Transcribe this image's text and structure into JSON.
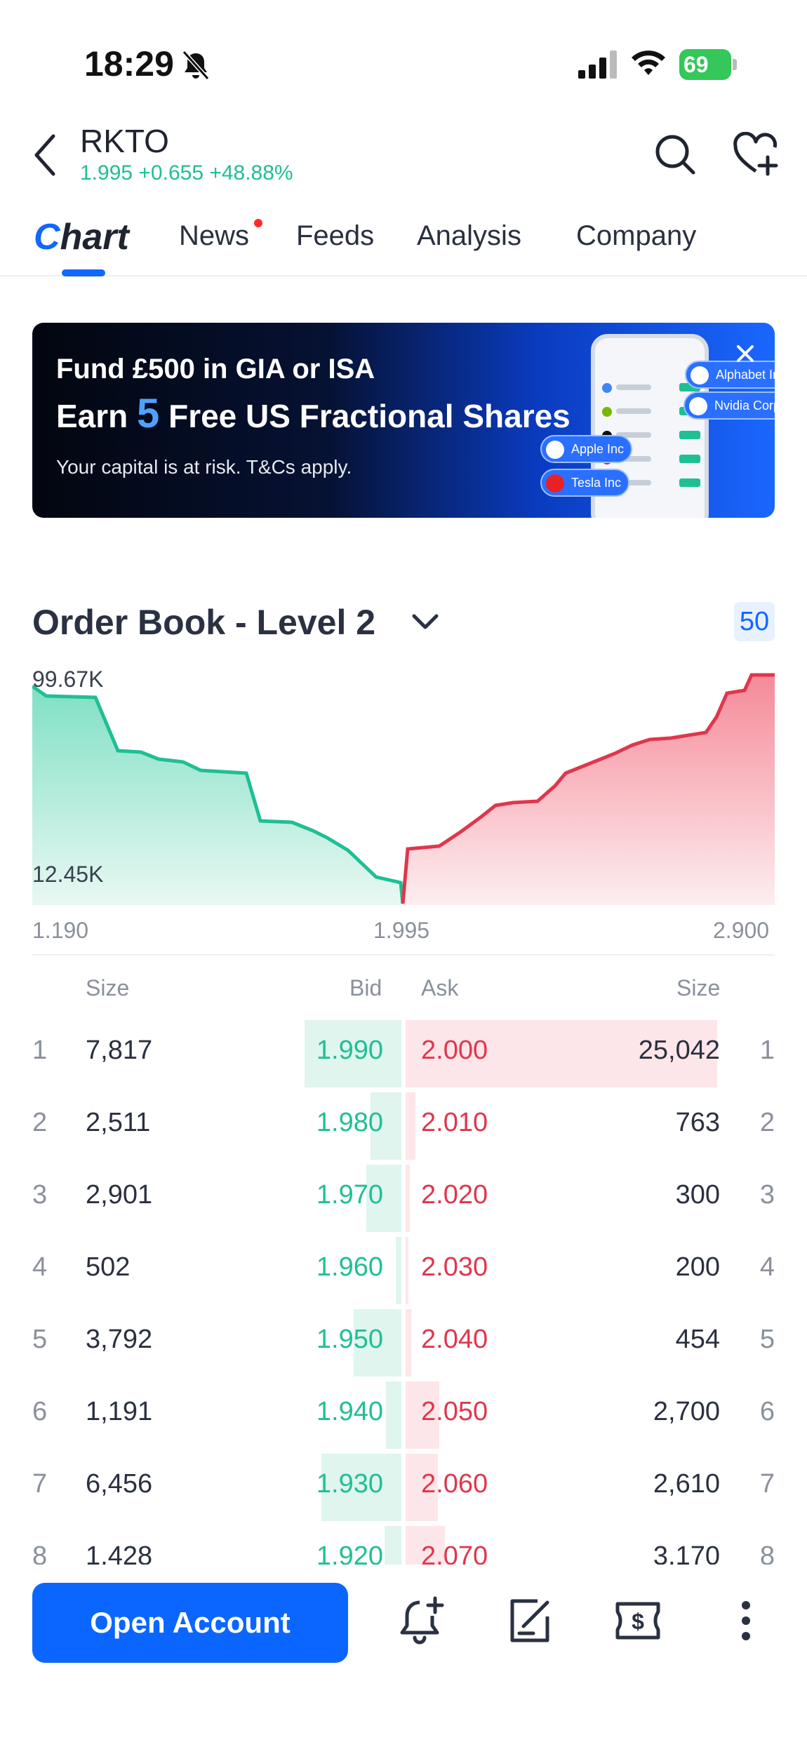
{
  "status_bar": {
    "time": "18:29",
    "battery": "69"
  },
  "header": {
    "symbol": "RKTO",
    "quote": "1.995 +0.655 +48.88%"
  },
  "tabs": [
    {
      "label": "Chart",
      "active": true
    },
    {
      "label": "News",
      "has_dot": true
    },
    {
      "label": "Feeds"
    },
    {
      "label": "Analysis"
    },
    {
      "label": "Company"
    }
  ],
  "tab_chart_first": "C",
  "tab_chart_rest": "hart",
  "banner": {
    "line1": "Fund £500 in GIA or ISA",
    "line2_prefix": "Earn ",
    "line2_number": "5",
    "line2_suffix": " Free US Fractional Shares",
    "line3": "Your capital is at risk. T&Cs apply.",
    "chips": [
      "Alphabet Inc",
      "Nvidia Corporation",
      "Apple Inc",
      "Tesla Inc"
    ]
  },
  "order_book": {
    "title": "Order Book - Level 2",
    "depth": "50",
    "chart": {
      "y_max_label": "99.67K",
      "y_min_label": "12.45K",
      "x_left": "1.190",
      "x_mid": "1.995",
      "x_right": "2.900"
    },
    "headers": {
      "bid_size": "Size",
      "bid": "Bid",
      "ask": "Ask",
      "ask_size": "Size"
    },
    "rows": [
      {
        "idx": "1",
        "bid_size": "7,817",
        "bid": "1.990",
        "ask": "2.000",
        "ask_size": "25,042"
      },
      {
        "idx": "2",
        "bid_size": "2,511",
        "bid": "1.980",
        "ask": "2.010",
        "ask_size": "763"
      },
      {
        "idx": "3",
        "bid_size": "2,901",
        "bid": "1.970",
        "ask": "2.020",
        "ask_size": "300"
      },
      {
        "idx": "4",
        "bid_size": "502",
        "bid": "1.960",
        "ask": "2.030",
        "ask_size": "200"
      },
      {
        "idx": "5",
        "bid_size": "3,792",
        "bid": "1.950",
        "ask": "2.040",
        "ask_size": "454"
      },
      {
        "idx": "6",
        "bid_size": "1,191",
        "bid": "1.940",
        "ask": "2.050",
        "ask_size": "2,700"
      },
      {
        "idx": "7",
        "bid_size": "6,456",
        "bid": "1.930",
        "ask": "2.060",
        "ask_size": "2,610"
      },
      {
        "idx": "8",
        "bid_size": "1,428",
        "bid": "1.920",
        "ask": "2.070",
        "ask_size": "3,170"
      }
    ]
  },
  "bottom_bar": {
    "open_account": "Open Account"
  },
  "colors": {
    "accent": "#0a66ff",
    "bid": "#1fbf94",
    "ask": "#e0364d"
  }
}
